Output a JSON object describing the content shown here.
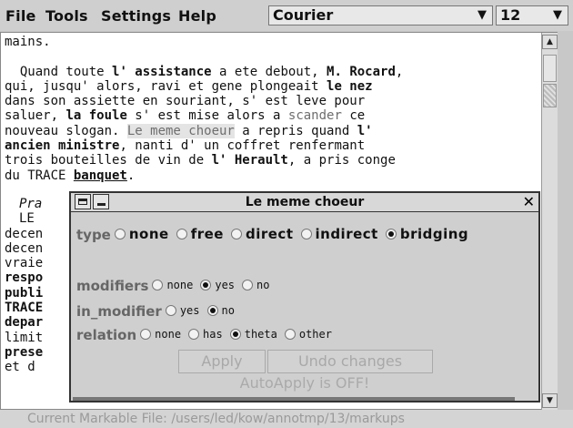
{
  "menubar": {
    "items": [
      "File",
      "Tools",
      "Settings",
      "Help"
    ],
    "font_select": "Courier",
    "size_select": "12"
  },
  "editor": {
    "lines": [
      "mains.",
      "",
      "  Quand toute l' assistance a ete debout, M. Rocard,",
      "qui, jusqu' alors, ravi et gene plongeait le nez",
      "dans son assiette en souriant, s' est leve pour",
      "saluer, la foule s' est mise alors a scander ce",
      "nouveau slogan. Le meme choeur a repris quand l'",
      "ancien ministre, nanti d' un coffret renfermant",
      "trois bouteilles de vin de l' Herault, a pris conge",
      "du TRACE banquet."
    ],
    "left_fragments": [
      "Pra",
      "",
      "LE",
      "decen",
      "decen",
      "vraie",
      "respo",
      "publi",
      "TRACE",
      "depar",
      "limit",
      "prese",
      "et d"
    ]
  },
  "statusbar": {
    "text": "Current Markable File: /users/led/kow/annotmp/13/markups"
  },
  "dialog": {
    "title": "Le meme choeur",
    "type": {
      "label": "type",
      "options": [
        "none",
        "free",
        "direct",
        "indirect",
        "bridging"
      ],
      "selected": "bridging"
    },
    "modifiers": {
      "label": "modifiers",
      "options": [
        "none",
        "yes",
        "no"
      ],
      "selected": "yes"
    },
    "in_modifier": {
      "label": "in_modifier",
      "options": [
        "yes",
        "no"
      ],
      "selected": "no"
    },
    "relation": {
      "label": "relation",
      "options": [
        "none",
        "has",
        "theta",
        "other"
      ],
      "selected": "theta"
    },
    "apply_label": "Apply",
    "undo_label": "Undo changes",
    "autoapply_text": "AutoApply is OFF!"
  }
}
